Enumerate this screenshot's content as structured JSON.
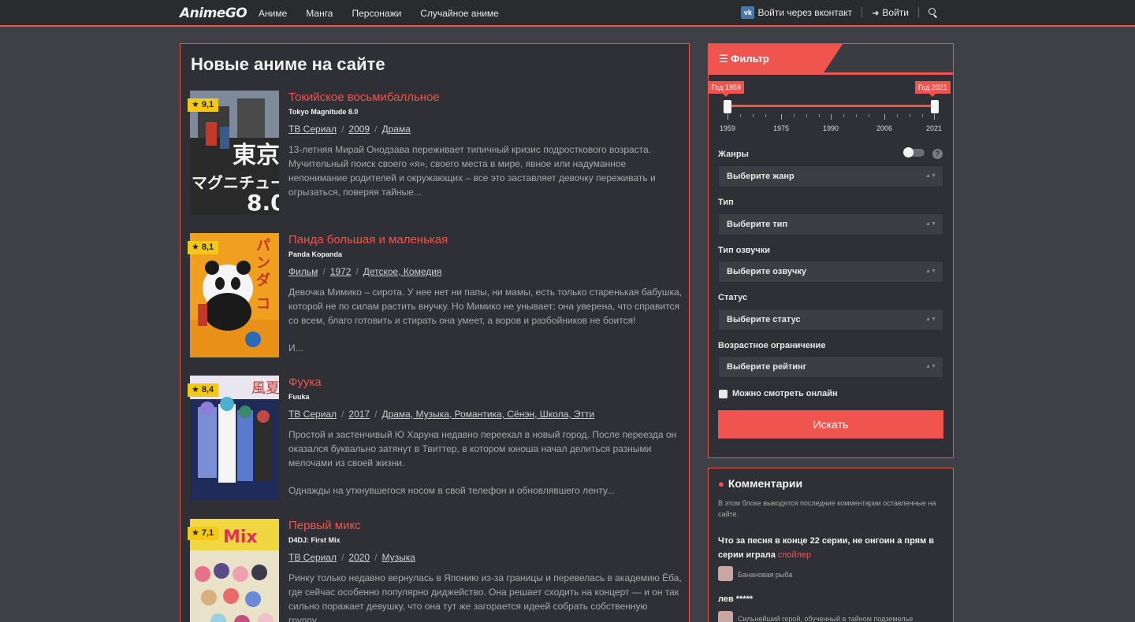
{
  "nav": {
    "logo": "AnimeGO",
    "links": [
      "Аниме",
      "Манга",
      "Персонажи",
      "Случайное аниме"
    ],
    "vk_login": "Войти через вконтакт",
    "login": "Войти"
  },
  "main": {
    "title": "Новые аниме на сайте",
    "items": [
      {
        "title": "Токийское восьмибалльное",
        "orig": "Tokyo Magnitude 8.0",
        "rating": "9,1",
        "type": "ТВ Сериал",
        "year": "2009",
        "genres": "Драма",
        "desc": [
          "13-летняя Мирай Онодзава переживает типичный кризис подросткового возраста. Мучительный поиск своего «я», своего места в мире, явное или надуманное непонимание родителей и окружающих – все это заставляет девочку переживать и огрызаться, поверяя тайные..."
        ]
      },
      {
        "title": "Панда большая и маленькая",
        "orig": "Panda Kopanda",
        "rating": "8,1",
        "type": "Фильм",
        "year": "1972",
        "genres": "Детское, Комедия",
        "desc": [
          "Девочка Мимико – сирота. У нее нет ни папы, ни мамы, есть только старенькая бабушка, которой не по силам растить внучку. Но Мимико не унывает; она уверена, что справится со всем, благо готовить и стирать она умеет, а воров и разбойников не боится!",
          "И..."
        ]
      },
      {
        "title": "Фуука",
        "orig": "Fuuka",
        "rating": "8,4",
        "type": "ТВ Сериал",
        "year": "2017",
        "genres": "Драма, Музыка, Романтика, Сёнэн, Школа, Этти",
        "desc": [
          "Простой и застенчивый Ю Харуна недавно переехал в новый город. После переезда он оказался буквально затянут в Твиттер, в котором юноша начал делиться разными мелочами из своей жизни.",
          "Однажды на уткнувшегося носом в свой телефон и обновлявшего ленту..."
        ]
      },
      {
        "title": "Первый микс",
        "orig": "D4DJ: First Mix",
        "rating": "7,1",
        "type": "ТВ Сериал",
        "year": "2020",
        "genres": "Музыка",
        "desc": [
          "Ринку только недавно вернулась в Японию из-за границы и перевелась в академию Ёба, где сейчас особенно популярно диджейство. Она решает сходить на концерт — и он так сильно поражает девушку, что она тут же загорается идеей собрать собственную группу..."
        ]
      }
    ]
  },
  "filter": {
    "title": "Фильтр",
    "year_from": "Год 1959",
    "year_to": "Год 2021",
    "ticks": [
      "1959",
      "1975",
      "1990",
      "2006",
      "2021"
    ],
    "genres_label": "Жанры",
    "genres_ph": "Выберите жанр",
    "type_label": "Тип",
    "type_ph": "Выберите тип",
    "voice_label": "Тип озвучки",
    "voice_ph": "Выберите озвучку",
    "status_label": "Статус",
    "status_ph": "Выберите статус",
    "age_label": "Возрастное ограничение",
    "age_ph": "Выберите рейтинг",
    "online_label": "Можно смотреть онлайн",
    "search_btn": "Искать"
  },
  "comments": {
    "title": "Комментарии",
    "intro": "В этом блоке выводятся последние комментарии оставленные на сайте.",
    "c1_text": "Что за песня в конце 22 серии, не онгоин а прям в серии играла",
    "c1_spoiler": "спойлер",
    "c1_author": "Банановая рыба",
    "c2_text": "лев *****",
    "c2_author": "Сильнейший герой, обученный в тайном подземелье"
  }
}
